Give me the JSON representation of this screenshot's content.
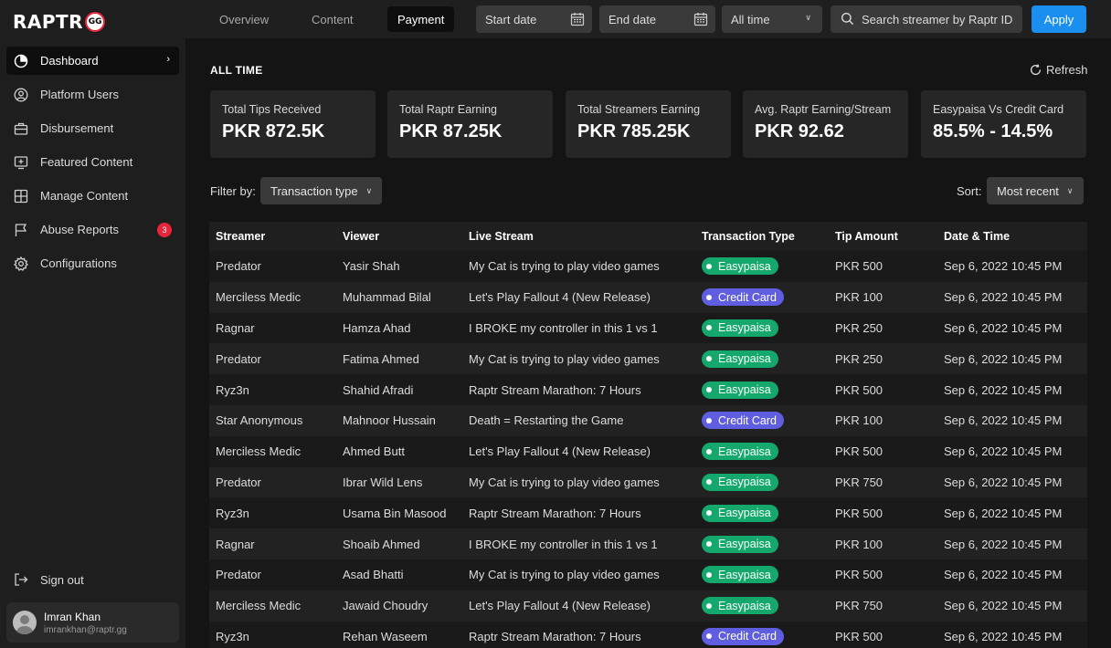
{
  "app": {
    "logo_text": "RAPTR",
    "logo_badge": "GG"
  },
  "sidebar": {
    "items": [
      {
        "label": "Dashboard",
        "icon": "pie-chart-icon",
        "active": true
      },
      {
        "label": "Platform Users",
        "icon": "user-circle-icon"
      },
      {
        "label": "Disbursement",
        "icon": "briefcase-icon"
      },
      {
        "label": "Featured Content",
        "icon": "featured-screen-icon"
      },
      {
        "label": "Manage Content",
        "icon": "grid-icon"
      },
      {
        "label": "Abuse Reports",
        "icon": "flag-icon",
        "badge": "3"
      },
      {
        "label": "Configurations",
        "icon": "gear-icon"
      }
    ],
    "signout_label": "Sign out",
    "user": {
      "name": "Imran Khan",
      "email": "imrankhan@raptr.gg"
    }
  },
  "topbar": {
    "tabs": [
      "Overview",
      "Content",
      "Payment"
    ],
    "active_tab": "Payment",
    "start_date_placeholder": "Start date",
    "end_date_placeholder": "End date",
    "range_select": "All time",
    "search_placeholder": "Search streamer by Raptr ID",
    "apply_label": "Apply"
  },
  "summary": {
    "title": "ALL TIME",
    "refresh_label": "Refresh",
    "cards": [
      {
        "label": "Total Tips Received",
        "value": "PKR 872.5K"
      },
      {
        "label": "Total Raptr Earning",
        "value": "PKR 87.25K"
      },
      {
        "label": "Total Streamers Earning",
        "value": "PKR 785.25K"
      },
      {
        "label": "Avg. Raptr Earning/Stream",
        "value": "PKR 92.62"
      },
      {
        "label": "Easypaisa Vs Credit Card",
        "value": "85.5% - 14.5%"
      }
    ]
  },
  "filters": {
    "filter_label": "Filter by:",
    "filter_value": "Transaction type",
    "sort_label": "Sort:",
    "sort_value": "Most recent"
  },
  "table": {
    "columns": [
      "Streamer",
      "Viewer",
      "Live Stream",
      "Transaction Type",
      "Tip Amount",
      "Date & Time"
    ],
    "rows": [
      [
        "Predator",
        "Yasir Shah",
        "My Cat is trying to play video games",
        "Easypaisa",
        "PKR 500",
        "Sep 6, 2022 10:45 PM"
      ],
      [
        "Merciless Medic",
        "Muhammad Bilal",
        "Let's Play Fallout 4 (New Release)",
        "Credit Card",
        "PKR 100",
        "Sep 6, 2022 10:45 PM"
      ],
      [
        "Ragnar",
        "Hamza Ahad",
        "I BROKE my controller in this 1 vs 1",
        "Easypaisa",
        "PKR 250",
        "Sep 6, 2022 10:45 PM"
      ],
      [
        "Predator",
        "Fatima Ahmed",
        "My Cat is trying to play video games",
        "Easypaisa",
        "PKR 250",
        "Sep 6, 2022 10:45 PM"
      ],
      [
        "Ryz3n",
        "Shahid Afradi",
        "Raptr Stream Marathon: 7 Hours",
        "Easypaisa",
        "PKR 500",
        "Sep 6, 2022 10:45 PM"
      ],
      [
        "Star Anonymous",
        "Mahnoor Hussain",
        "Death = Restarting the Game",
        "Credit Card",
        "PKR 100",
        "Sep 6, 2022 10:45 PM"
      ],
      [
        "Merciless Medic",
        "Ahmed Butt",
        "Let's Play Fallout 4 (New Release)",
        "Easypaisa",
        "PKR 500",
        "Sep 6, 2022 10:45 PM"
      ],
      [
        "Predator",
        "Ibrar Wild Lens",
        "My Cat is trying to play video games",
        "Easypaisa",
        "PKR 750",
        "Sep 6, 2022 10:45 PM"
      ],
      [
        "Ryz3n",
        "Usama Bin Masood",
        "Raptr Stream Marathon: 7 Hours",
        "Easypaisa",
        "PKR 500",
        "Sep 6, 2022 10:45 PM"
      ],
      [
        "Ragnar",
        "Shoaib Ahmed",
        "I BROKE my controller in this 1 vs 1",
        "Easypaisa",
        "PKR 100",
        "Sep 6, 2022 10:45 PM"
      ],
      [
        "Predator",
        "Asad Bhatti",
        "My Cat is trying to play video games",
        "Easypaisa",
        "PKR 500",
        "Sep 6, 2022 10:45 PM"
      ],
      [
        "Merciless Medic",
        "Jawaid Choudry",
        "Let's Play Fallout 4 (New Release)",
        "Easypaisa",
        "PKR 750",
        "Sep 6, 2022 10:45 PM"
      ],
      [
        "Ryz3n",
        "Rehan Waseem",
        "Raptr Stream Marathon: 7 Hours",
        "Credit Card",
        "PKR 500",
        "Sep 6, 2022 10:45 PM"
      ]
    ]
  },
  "colors": {
    "accent": "#1a8ff0",
    "easypaisa": "#14a86c",
    "credit_card": "#5f5ee0",
    "badge": "#e8253b"
  }
}
